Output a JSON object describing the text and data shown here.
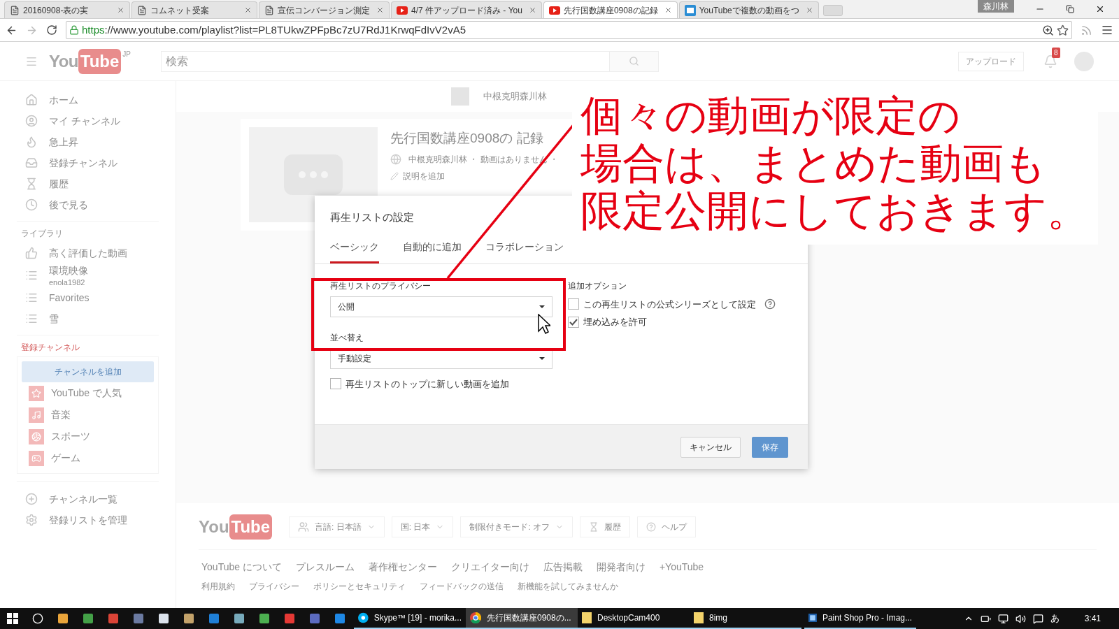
{
  "browser": {
    "tabs": [
      {
        "title": "20160908-表の実",
        "kind": "page",
        "selected": false
      },
      {
        "title": "コムネット受案",
        "kind": "page",
        "selected": false
      },
      {
        "title": "宣伝コンバージョン測定",
        "kind": "page",
        "selected": false
      },
      {
        "title": "4/7 件アップロード済み - You",
        "kind": "video",
        "selected": false
      },
      {
        "title": "先行国数講座0908の記録",
        "kind": "video",
        "selected": true
      },
      {
        "title": "YouTubeで複数の動画をつ",
        "kind": "doc",
        "selected": false
      }
    ],
    "user": "森川林",
    "url_scheme": "https",
    "url_rest": "://www.youtube.com/playlist?list=PL8TUkwZPFpBc7zU7RdJ1KrwqFdIvV2vA5"
  },
  "header": {
    "logo_you": "You",
    "logo_tube": "Tube",
    "region": "JP",
    "search_placeholder": "検索",
    "upload": "アップロード",
    "notification_count": "8"
  },
  "sidebar": {
    "main_items": [
      {
        "label": "ホーム",
        "kind": "home"
      },
      {
        "label": "マイ チャンネル",
        "kind": "user"
      },
      {
        "label": "急上昇",
        "kind": "flame"
      },
      {
        "label": "登録チャンネル",
        "kind": "inbox"
      },
      {
        "label": "履歴",
        "kind": "hourglass"
      },
      {
        "label": "後で見る",
        "kind": "clock"
      }
    ],
    "library_heading": "ライブラリ",
    "library_items": [
      {
        "label": "高く評価した動画",
        "kind": "thumb"
      },
      {
        "label": "環境映像",
        "sub": "enola1982",
        "kind": "list"
      },
      {
        "label": "Favorites",
        "kind": "list"
      },
      {
        "label": "雪",
        "kind": "list"
      }
    ],
    "subscriptions_heading": "登録チャンネル",
    "add_channel": "チャンネルを追加",
    "channels": [
      {
        "label": "YouTube で人気",
        "kind": "star"
      },
      {
        "label": "音楽",
        "kind": "music"
      },
      {
        "label": "スポーツ",
        "kind": "ball"
      },
      {
        "label": "ゲーム",
        "kind": "game"
      }
    ],
    "bottom_items": [
      {
        "label": "チャンネル一覧",
        "kind": "plus"
      },
      {
        "label": "登録リストを管理",
        "kind": "gear"
      }
    ]
  },
  "playlist": {
    "owner": "中根克明森川林",
    "title": "先行国数講座0908の 記録",
    "meta": "中根克明森川林 ・ 動画はありません ・",
    "add_description": "説明を追加"
  },
  "dialog": {
    "title": "再生リストの設定",
    "tabs": [
      {
        "label": "ベーシック",
        "selected": true
      },
      {
        "label": "自動的に追加",
        "selected": false
      },
      {
        "label": "コラボレーション",
        "selected": false
      }
    ],
    "privacy_label": "再生リストのプライバシー",
    "privacy_value": "公開",
    "sort_label": "並べ替え",
    "sort_value": "手動設定",
    "add_to_top": {
      "label": "再生リストのトップに新しい動画を追加",
      "checked": false
    },
    "options_heading": "追加オプション",
    "options": [
      {
        "label": "この再生リストの公式シリーズとして設定",
        "checked": false,
        "help": true
      },
      {
        "label": "埋め込みを許可",
        "checked": true,
        "help": false
      }
    ],
    "cancel": "キャンセル",
    "save": "保存"
  },
  "annotation": {
    "lines": [
      "個々の動画が限定の",
      "場合は、まとめた動画も",
      "限定公開にしておきます。"
    ]
  },
  "footer": {
    "logo_you": "You",
    "logo_tube": "Tube",
    "buttons": [
      {
        "label": "言語: 日本語",
        "kind": "people",
        "dropdown": true
      },
      {
        "label": "国: 日本",
        "kind": "plain",
        "dropdown": true
      },
      {
        "label": "制限付きモード: オフ",
        "kind": "plain",
        "dropdown": true
      },
      {
        "label": "履歴",
        "kind": "hourglass",
        "dropdown": false
      },
      {
        "label": "ヘルプ",
        "kind": "help",
        "dropdown": false
      }
    ],
    "links": [
      "YouTube について",
      "プレスルーム",
      "著作権センター",
      "クリエイター向け",
      "広告掲載",
      "開発者向け",
      "+YouTube"
    ],
    "small_links": [
      "利用規約",
      "プライバシー",
      "ポリシーとセキュリティ",
      "フィードバックの送信",
      "新機能を試してみませんか"
    ]
  },
  "taskbar": {
    "apps": [
      {
        "label": "Skype™ [19] - morika...",
        "kind": "chat",
        "active": false
      },
      {
        "label": "先行国数講座0908の...",
        "kind": "browser",
        "active": true
      },
      {
        "label": "DesktopCam400",
        "kind": "folder",
        "active": false
      },
      {
        "label": "8img",
        "kind": "folder",
        "active": false
      },
      {
        "label": "Paint Shop Pro - Imag...",
        "kind": "paint",
        "active": false
      }
    ],
    "ime": "あ",
    "time": "3:41"
  }
}
